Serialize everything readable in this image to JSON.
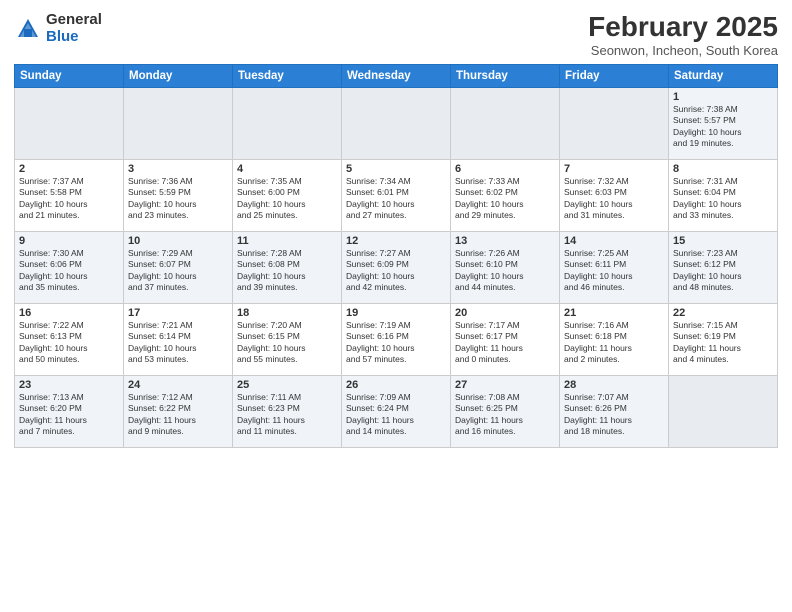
{
  "logo": {
    "general": "General",
    "blue": "Blue"
  },
  "header": {
    "month": "February 2025",
    "location": "Seonwon, Incheon, South Korea"
  },
  "weekdays": [
    "Sunday",
    "Monday",
    "Tuesday",
    "Wednesday",
    "Thursday",
    "Friday",
    "Saturday"
  ],
  "weeks": [
    [
      {
        "day": "",
        "info": ""
      },
      {
        "day": "",
        "info": ""
      },
      {
        "day": "",
        "info": ""
      },
      {
        "day": "",
        "info": ""
      },
      {
        "day": "",
        "info": ""
      },
      {
        "day": "",
        "info": ""
      },
      {
        "day": "1",
        "info": "Sunrise: 7:38 AM\nSunset: 5:57 PM\nDaylight: 10 hours\nand 19 minutes."
      }
    ],
    [
      {
        "day": "2",
        "info": "Sunrise: 7:37 AM\nSunset: 5:58 PM\nDaylight: 10 hours\nand 21 minutes."
      },
      {
        "day": "3",
        "info": "Sunrise: 7:36 AM\nSunset: 5:59 PM\nDaylight: 10 hours\nand 23 minutes."
      },
      {
        "day": "4",
        "info": "Sunrise: 7:35 AM\nSunset: 6:00 PM\nDaylight: 10 hours\nand 25 minutes."
      },
      {
        "day": "5",
        "info": "Sunrise: 7:34 AM\nSunset: 6:01 PM\nDaylight: 10 hours\nand 27 minutes."
      },
      {
        "day": "6",
        "info": "Sunrise: 7:33 AM\nSunset: 6:02 PM\nDaylight: 10 hours\nand 29 minutes."
      },
      {
        "day": "7",
        "info": "Sunrise: 7:32 AM\nSunset: 6:03 PM\nDaylight: 10 hours\nand 31 minutes."
      },
      {
        "day": "8",
        "info": "Sunrise: 7:31 AM\nSunset: 6:04 PM\nDaylight: 10 hours\nand 33 minutes."
      }
    ],
    [
      {
        "day": "9",
        "info": "Sunrise: 7:30 AM\nSunset: 6:06 PM\nDaylight: 10 hours\nand 35 minutes."
      },
      {
        "day": "10",
        "info": "Sunrise: 7:29 AM\nSunset: 6:07 PM\nDaylight: 10 hours\nand 37 minutes."
      },
      {
        "day": "11",
        "info": "Sunrise: 7:28 AM\nSunset: 6:08 PM\nDaylight: 10 hours\nand 39 minutes."
      },
      {
        "day": "12",
        "info": "Sunrise: 7:27 AM\nSunset: 6:09 PM\nDaylight: 10 hours\nand 42 minutes."
      },
      {
        "day": "13",
        "info": "Sunrise: 7:26 AM\nSunset: 6:10 PM\nDaylight: 10 hours\nand 44 minutes."
      },
      {
        "day": "14",
        "info": "Sunrise: 7:25 AM\nSunset: 6:11 PM\nDaylight: 10 hours\nand 46 minutes."
      },
      {
        "day": "15",
        "info": "Sunrise: 7:23 AM\nSunset: 6:12 PM\nDaylight: 10 hours\nand 48 minutes."
      }
    ],
    [
      {
        "day": "16",
        "info": "Sunrise: 7:22 AM\nSunset: 6:13 PM\nDaylight: 10 hours\nand 50 minutes."
      },
      {
        "day": "17",
        "info": "Sunrise: 7:21 AM\nSunset: 6:14 PM\nDaylight: 10 hours\nand 53 minutes."
      },
      {
        "day": "18",
        "info": "Sunrise: 7:20 AM\nSunset: 6:15 PM\nDaylight: 10 hours\nand 55 minutes."
      },
      {
        "day": "19",
        "info": "Sunrise: 7:19 AM\nSunset: 6:16 PM\nDaylight: 10 hours\nand 57 minutes."
      },
      {
        "day": "20",
        "info": "Sunrise: 7:17 AM\nSunset: 6:17 PM\nDaylight: 11 hours\nand 0 minutes."
      },
      {
        "day": "21",
        "info": "Sunrise: 7:16 AM\nSunset: 6:18 PM\nDaylight: 11 hours\nand 2 minutes."
      },
      {
        "day": "22",
        "info": "Sunrise: 7:15 AM\nSunset: 6:19 PM\nDaylight: 11 hours\nand 4 minutes."
      }
    ],
    [
      {
        "day": "23",
        "info": "Sunrise: 7:13 AM\nSunset: 6:20 PM\nDaylight: 11 hours\nand 7 minutes."
      },
      {
        "day": "24",
        "info": "Sunrise: 7:12 AM\nSunset: 6:22 PM\nDaylight: 11 hours\nand 9 minutes."
      },
      {
        "day": "25",
        "info": "Sunrise: 7:11 AM\nSunset: 6:23 PM\nDaylight: 11 hours\nand 11 minutes."
      },
      {
        "day": "26",
        "info": "Sunrise: 7:09 AM\nSunset: 6:24 PM\nDaylight: 11 hours\nand 14 minutes."
      },
      {
        "day": "27",
        "info": "Sunrise: 7:08 AM\nSunset: 6:25 PM\nDaylight: 11 hours\nand 16 minutes."
      },
      {
        "day": "28",
        "info": "Sunrise: 7:07 AM\nSunset: 6:26 PM\nDaylight: 11 hours\nand 18 minutes."
      },
      {
        "day": "",
        "info": ""
      }
    ]
  ]
}
